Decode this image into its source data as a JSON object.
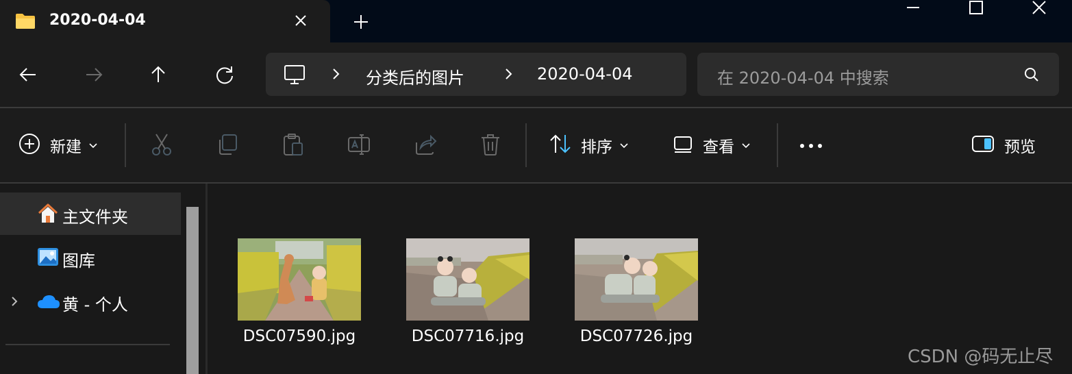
{
  "window": {
    "tab_title": "2020-04-04",
    "icons": {
      "tab": "folder-icon",
      "close_tab": "close-icon",
      "new_tab": "plus-icon",
      "minimize": "minimize-icon",
      "maximize": "maximize-icon",
      "close_window": "close-icon"
    }
  },
  "navigation": {
    "back": "arrow-left-icon",
    "forward": "arrow-right-icon",
    "up": "arrow-up-icon",
    "refresh": "refresh-icon",
    "breadcrumb": [
      "分类后的图片",
      "2020-04-04"
    ],
    "search_placeholder": "在 2020-04-04 中搜索"
  },
  "command_bar": {
    "new_label": "新建",
    "sort_label": "排序",
    "view_label": "查看",
    "preview_label": "预览",
    "icons": [
      "cut-icon",
      "copy-icon",
      "paste-icon",
      "rename-icon",
      "share-icon",
      "delete-icon",
      "more-icon"
    ]
  },
  "nav_pane": {
    "items": [
      {
        "label": "主文件夹",
        "icon": "home-icon",
        "selected": true
      },
      {
        "label": "图库",
        "icon": "gallery-icon",
        "selected": false
      },
      {
        "label": "黄 - 个人",
        "icon": "onedrive-icon",
        "selected": false
      }
    ]
  },
  "files": [
    {
      "name": "DSC07590.jpg"
    },
    {
      "name": "DSC07716.jpg"
    },
    {
      "name": "DSC07726.jpg"
    }
  ],
  "watermark": "CSDN @码无止尽",
  "colors": {
    "background": "#191919",
    "chrome": "#1c1c1c",
    "tab_strip": "#020b18",
    "field": "#2c2c2c",
    "accent": "#4cc2ff"
  }
}
